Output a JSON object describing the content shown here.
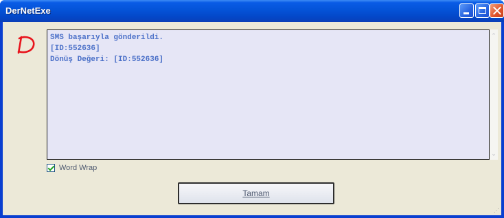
{
  "window": {
    "title": "DerNetExe"
  },
  "textarea": {
    "lines": [
      "SMS başarıyla gönderildi.",
      "[ID:552636]",
      "Dönüş Değeri: [ID:552636]"
    ]
  },
  "word_wrap": {
    "label": "Word Wrap",
    "checked": true
  },
  "ok_button": {
    "label": "Tamam"
  },
  "icons": [
    "app-d-logo-icon",
    "minimize-icon",
    "maximize-icon",
    "close-icon",
    "checkmark-icon",
    "scroll-up-icon",
    "scroll-down-icon",
    "resize-grip-icon"
  ],
  "colors": {
    "title_bar": "#0453d8",
    "text": "#4b70c8",
    "textarea_bg": "#e6e6f6",
    "face": "#ece9d8"
  }
}
